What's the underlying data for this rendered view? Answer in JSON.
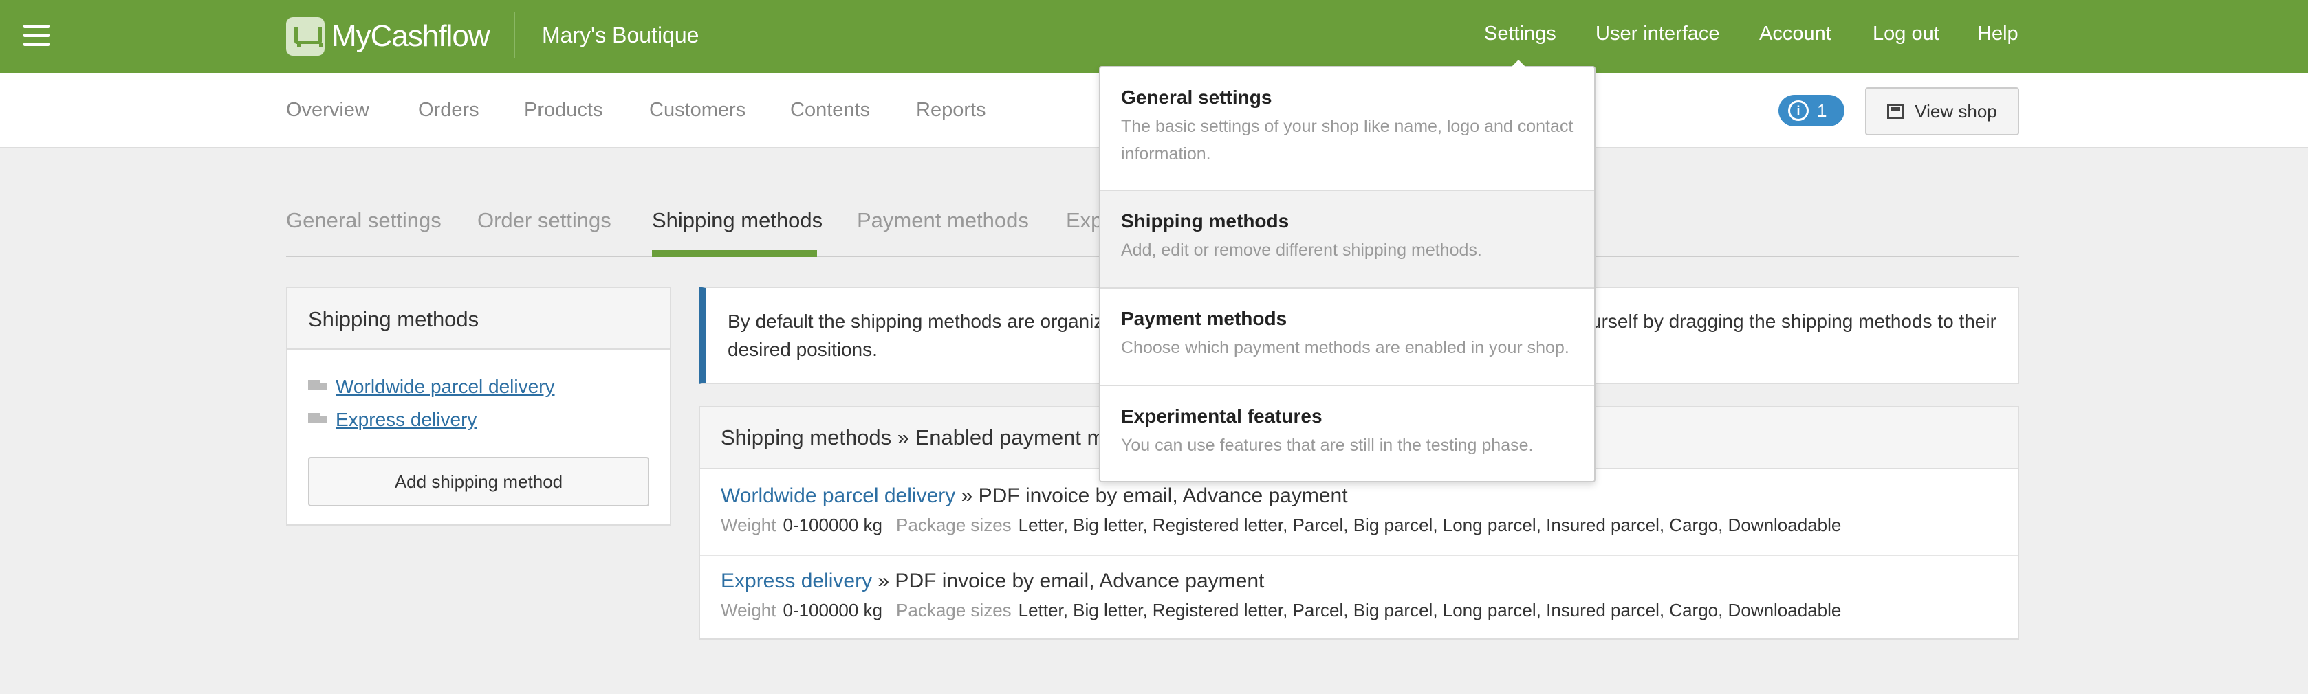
{
  "app": {
    "brand": "MyCashflow",
    "shop_name": "Mary's Boutique"
  },
  "topnav": [
    "Settings",
    "User interface",
    "Account",
    "Log out",
    "Help"
  ],
  "subnav": [
    "Overview",
    "Orders",
    "Products",
    "Customers",
    "Contents",
    "Reports"
  ],
  "notifications": {
    "count": "1",
    "icon": "info-icon"
  },
  "view_shop": "View shop",
  "tabs": [
    "General settings",
    "Order settings",
    "Shipping methods",
    "Payment methods",
    "Exp"
  ],
  "left_panel": {
    "title": "Shipping methods",
    "links": [
      "Worldwide parcel delivery",
      "Express delivery"
    ],
    "add_button": "Add shipping method"
  },
  "info": {
    "line1_a": "By default the shipping methods are organize",
    "line1_b": "urself by dragging the shipping methods to their",
    "line2": "desired positions."
  },
  "main": {
    "title": "Shipping methods » Enabled payment m",
    "rows": [
      {
        "name": "Worldwide parcel delivery",
        "payments": " » PDF invoice by email, Advance payment",
        "weight_label": "Weight",
        "weight": "0-100000 kg",
        "sizes_label": "Package sizes",
        "sizes": "Letter, Big letter, Registered letter, Parcel, Big parcel, Long parcel, Insured parcel, Cargo, Downloadable"
      },
      {
        "name": "Express delivery",
        "payments": " » PDF invoice by email, Advance payment",
        "weight_label": "Weight",
        "weight": "0-100000 kg",
        "sizes_label": "Package sizes",
        "sizes": "Letter, Big letter, Registered letter, Parcel, Big parcel, Long parcel, Insured parcel, Cargo, Downloadable"
      }
    ]
  },
  "dropdown": [
    {
      "title": "General settings",
      "desc": "The basic settings of your shop like name, logo and contact information."
    },
    {
      "title": "Shipping methods",
      "desc": "Add, edit or remove different shipping methods."
    },
    {
      "title": "Payment methods",
      "desc": "Choose which payment methods are enabled in your shop."
    },
    {
      "title": "Experimental features",
      "desc": "You can use features that are still in the testing phase."
    }
  ],
  "colors": {
    "brand_green": "#6a9e3a",
    "link_blue": "#2d6fa3",
    "badge_blue": "#3a8cc8"
  }
}
